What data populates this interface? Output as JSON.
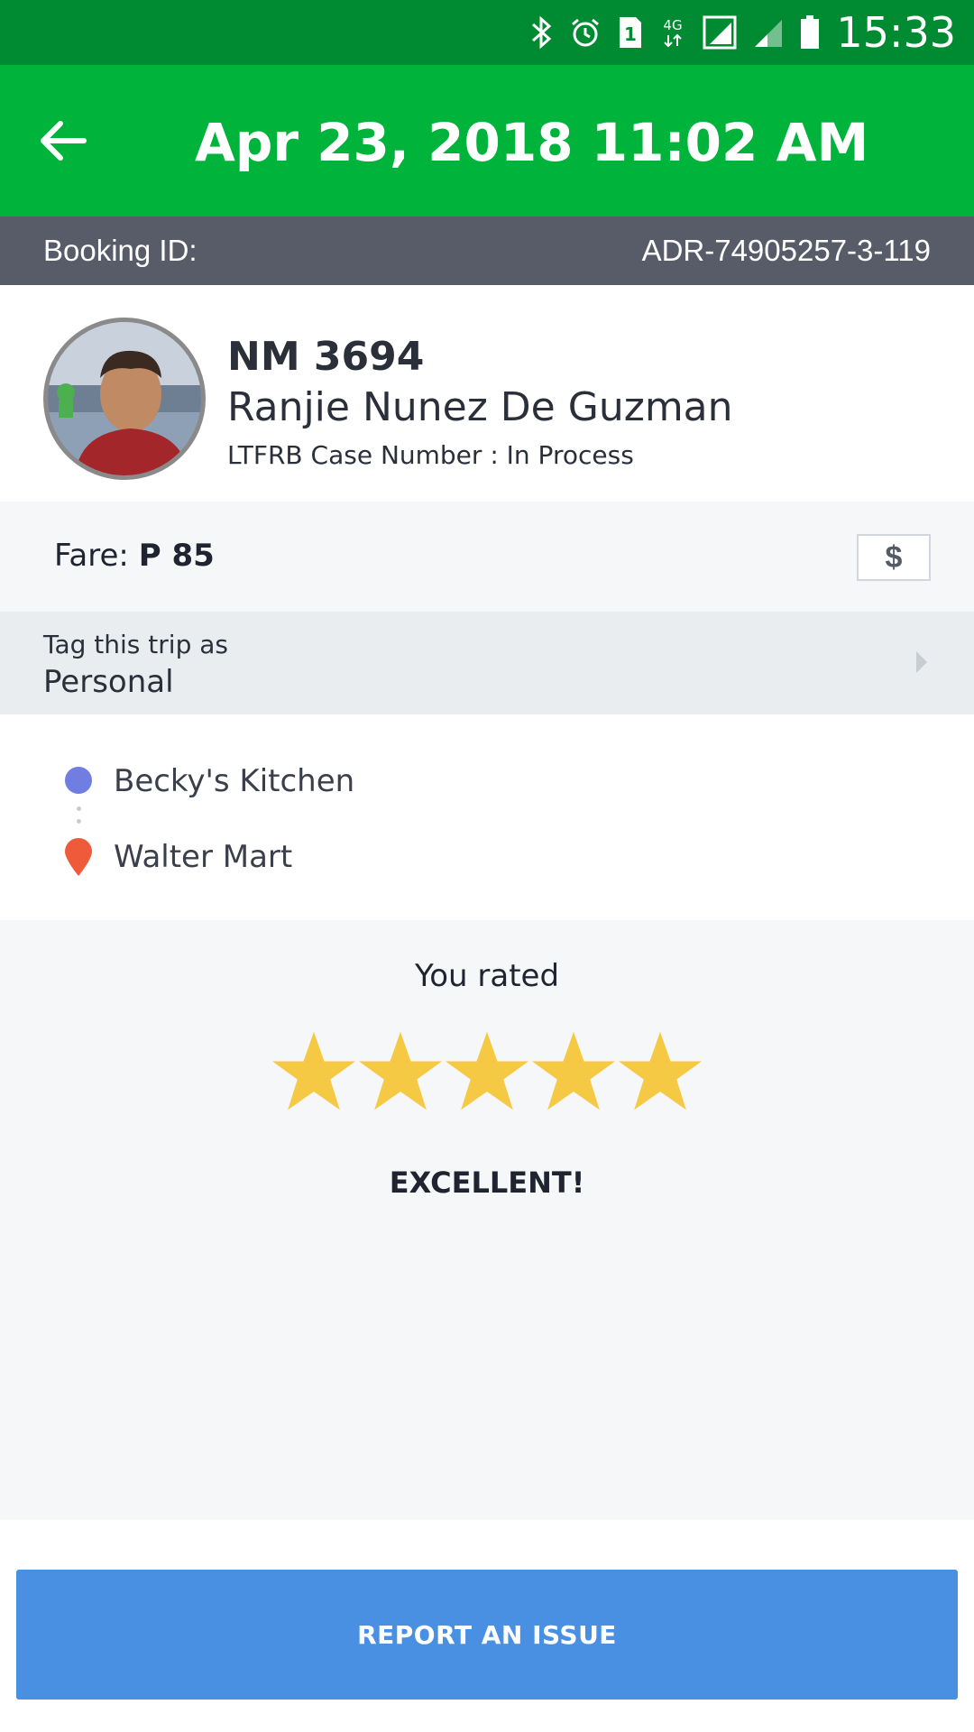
{
  "status_bar": {
    "time": "15:33",
    "sim_slot": "1",
    "network": "4G"
  },
  "header": {
    "title": "Apr 23, 2018 11:02 AM"
  },
  "booking": {
    "label": "Booking ID:",
    "value": "ADR-74905257-3-119"
  },
  "driver": {
    "plate": "NM 3694",
    "name": "Ranjie Nunez De Guzman",
    "case_number": "LTFRB Case Number : In Process"
  },
  "fare": {
    "label": "Fare:",
    "value": "P 85",
    "icon": "dollar-icon"
  },
  "tag": {
    "label": "Tag this trip as",
    "value": "Personal"
  },
  "route": {
    "pickup": "Becky's Kitchen",
    "dropoff": "Walter Mart"
  },
  "rating": {
    "label": "You rated",
    "stars": 5,
    "max_stars": 5,
    "word": "EXCELLENT!"
  },
  "actions": {
    "report_label": "REPORT AN ISSUE"
  },
  "colors": {
    "status_bar": "#008a32",
    "app_bar": "#00b33b",
    "booking_bar": "#585c68",
    "star": "#f6c945",
    "pickup": "#6f7ee0",
    "dropoff": "#ef5a3a",
    "report_button": "#4a90e2"
  }
}
